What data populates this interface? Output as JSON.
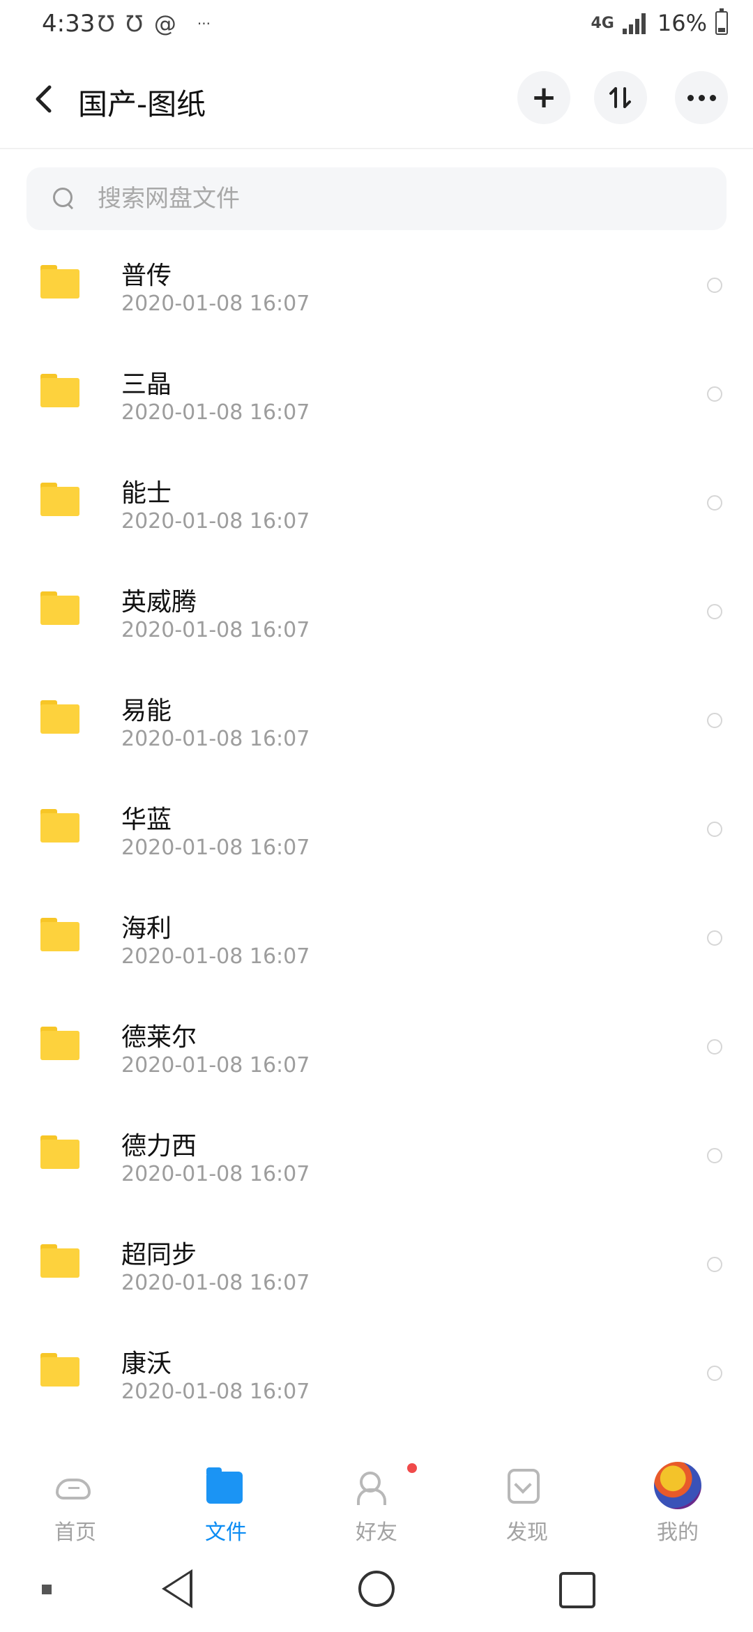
{
  "status_bar": {
    "time": "4:33",
    "left_icons": [
      "notification-app-icon",
      "notification-app-icon",
      "swirl-icon"
    ],
    "ellipsis": "···",
    "network": "4G",
    "battery_text": "16%"
  },
  "header": {
    "title": "国产-图纸",
    "plus": "+",
    "sort": "⇅"
  },
  "search": {
    "placeholder": "搜索网盘文件"
  },
  "folders": [
    {
      "name": "普传",
      "date": "2020-01-08  16:07"
    },
    {
      "name": "三晶",
      "date": "2020-01-08  16:07"
    },
    {
      "name": "能士",
      "date": "2020-01-08  16:07"
    },
    {
      "name": "英威腾",
      "date": "2020-01-08  16:07"
    },
    {
      "name": "易能",
      "date": "2020-01-08  16:07"
    },
    {
      "name": "华蓝",
      "date": "2020-01-08  16:07"
    },
    {
      "name": "海利",
      "date": "2020-01-08  16:07"
    },
    {
      "name": "德莱尔",
      "date": "2020-01-08  16:07"
    },
    {
      "name": "德力西",
      "date": "2020-01-08  16:07"
    },
    {
      "name": "超同步",
      "date": "2020-01-08  16:07"
    },
    {
      "name": "康沃",
      "date": "2020-01-08  16:07"
    }
  ],
  "bottom_nav": [
    {
      "label": "首页",
      "icon": "cloud-icon"
    },
    {
      "label": "文件",
      "icon": "folder-icon",
      "active": true
    },
    {
      "label": "好友",
      "icon": "friends-icon",
      "badge": true
    },
    {
      "label": "发现",
      "icon": "discover-icon"
    },
    {
      "label": "我的",
      "icon": "avatar"
    }
  ],
  "colors": {
    "accent": "#0b8cf3",
    "folder": "#fdd23d",
    "badge": "#f04a4a"
  }
}
